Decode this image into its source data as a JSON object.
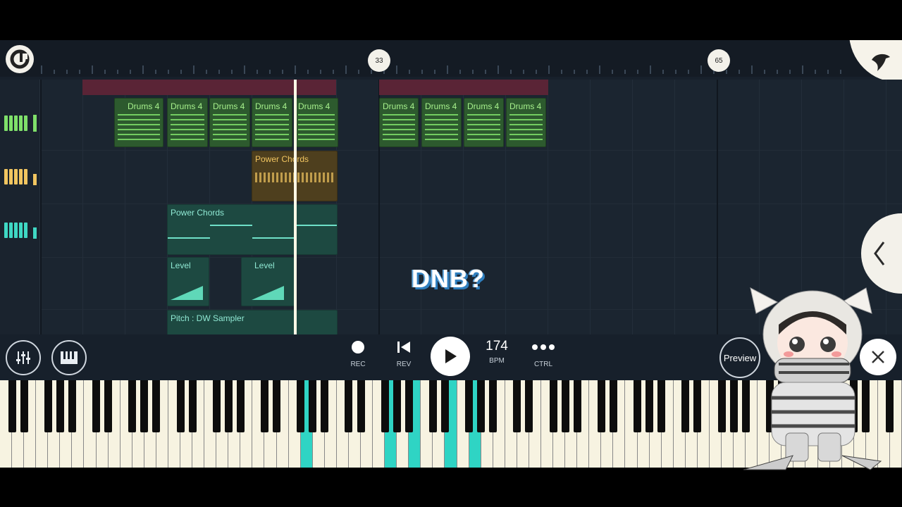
{
  "timeline": {
    "markers": [
      "33",
      "65"
    ]
  },
  "channels": [
    {
      "name": "drums-channel",
      "color": "#7fe06a"
    },
    {
      "name": "keys-channel",
      "color": "#f1c560"
    },
    {
      "name": "synth-channel",
      "color": "#3fd8c4"
    }
  ],
  "clips": {
    "drums": [
      "Drums 4",
      "Drums 4",
      "Drums 4",
      "Drums 4",
      "Drums 4",
      "Drums 4",
      "Drums 4",
      "Drums 4",
      "Drums 4"
    ],
    "power_chords_gold": "Power Chords",
    "power_chords_teal": "Power Chords",
    "level_1": "Level",
    "level_2": "Level",
    "pitch": "Pitch : DW Sampler"
  },
  "overlay": {
    "text": "DNB?"
  },
  "transport": {
    "rec_label": "REC",
    "rev_label": "REV",
    "bpm_value": "174",
    "bpm_label": "BPM",
    "ctrl_label": "CTRL",
    "preview_label": "Preview"
  },
  "colors": {
    "accent_teal": "#2fd4c4",
    "drum_green": "#7fe06a",
    "chord_gold": "#f1c560",
    "background": "#17202b"
  }
}
